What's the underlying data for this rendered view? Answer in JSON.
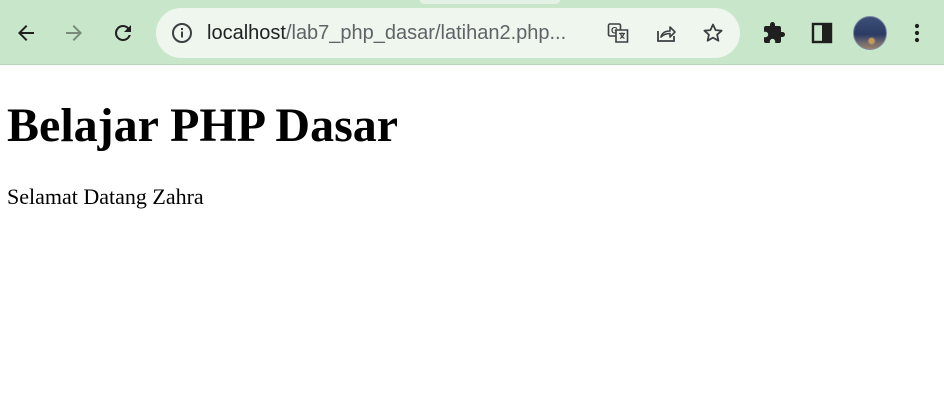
{
  "browser": {
    "url_host": "localhost",
    "url_path": "/lab7_php_dasar/latihan2.php...",
    "nav": {
      "back_icon": "arrow-left-icon",
      "forward_icon": "arrow-right-icon",
      "reload_icon": "reload-icon"
    },
    "omnibox_icons": [
      "info-icon",
      "translate-icon",
      "share-icon",
      "bookmark-star-icon"
    ],
    "toolbar_icons": [
      "extensions-icon",
      "side-panel-icon",
      "profile-avatar",
      "menu-icon"
    ],
    "theme_color": "#c8e6c9"
  },
  "page": {
    "heading": "Belajar PHP Dasar",
    "greeting": "Selamat Datang Zahra"
  }
}
